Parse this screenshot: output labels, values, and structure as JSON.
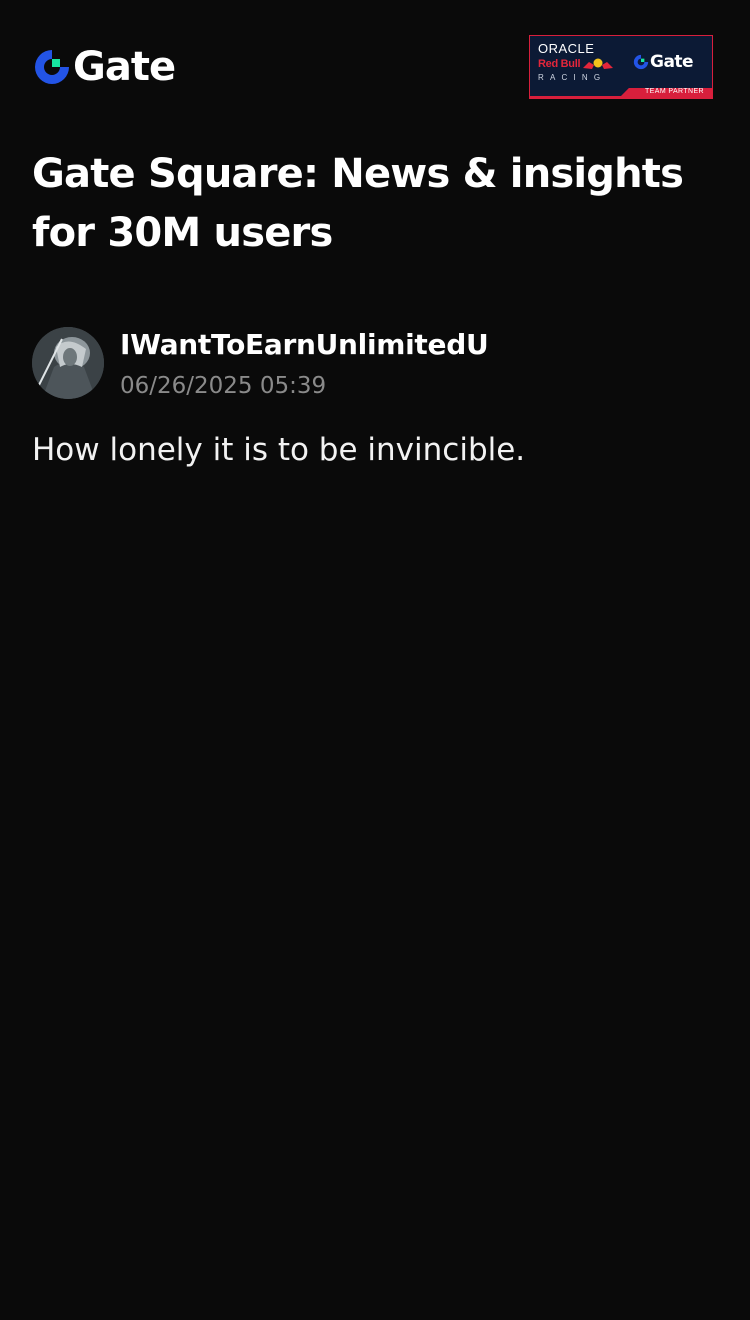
{
  "header": {
    "logo_text": "Gate",
    "logo_icon": "gate-logo-icon",
    "partner_banner": {
      "oracle": "ORACLE",
      "redbull": "Red Bull",
      "racing": "RACING",
      "gate_text": "Gate",
      "team_partner": "TEAM PARTNER"
    }
  },
  "page": {
    "title": "Gate Square: News & insights for 30M users"
  },
  "post": {
    "author": {
      "name": "IWantToEarnUnlimitedU",
      "avatar_icon": "user-avatar"
    },
    "timestamp": "06/26/2025 05:39",
    "content": "How lonely it is to be invincible."
  },
  "colors": {
    "background": "#0a0a0a",
    "text_primary": "#ffffff",
    "text_secondary": "#8a8a8a",
    "gate_blue": "#2354e6",
    "gate_green": "#17e6a1",
    "banner_navy": "#0c1a35",
    "redbull_red": "#d81f3c"
  }
}
